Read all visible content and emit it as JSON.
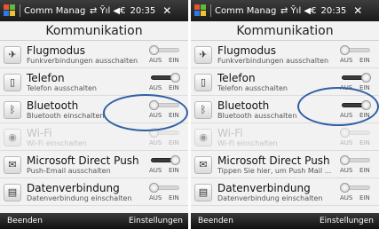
{
  "colors": {
    "highlight_ring": "#2f5fa5",
    "titlebar": "#1a1a1a",
    "toggle_on": "#3a3a3a"
  },
  "screens": [
    {
      "statusbar": {
        "app_title": "Comm Manage",
        "signal_text": "⇄ Ỹıl ◀€",
        "time": "20:35",
        "close": "✕"
      },
      "heading": "Kommunikation",
      "items": [
        {
          "title": "Flugmodus",
          "subtitle": "Funkverbindungen ausschalten",
          "icon": "airplane-icon",
          "state": "off",
          "enabled": true,
          "off_label": "AUS",
          "on_label": "EIN"
        },
        {
          "title": "Telefon",
          "subtitle": "Telefon ausschalten",
          "icon": "phone-icon",
          "state": "on",
          "enabled": true,
          "off_label": "AUS",
          "on_label": "EIN"
        },
        {
          "title": "Bluetooth",
          "subtitle": "Bluetooth einschalten",
          "icon": "bluetooth-icon",
          "state": "off",
          "enabled": true,
          "off_label": "AUS",
          "on_label": "EIN"
        },
        {
          "title": "Wi-Fi",
          "subtitle": "Wi-Fi einschalten",
          "icon": "wifi-icon",
          "state": "off",
          "enabled": false,
          "off_label": "AUS",
          "on_label": "EIN"
        },
        {
          "title": "Microsoft Direct Push",
          "subtitle": "Push-Email ausschalten",
          "icon": "push-mail-icon",
          "state": "on",
          "enabled": true,
          "off_label": "AUS",
          "on_label": "EIN"
        },
        {
          "title": "Datenverbindung",
          "subtitle": "Datenverbindung einschalten",
          "icon": "data-connection-icon",
          "state": "off",
          "enabled": true,
          "off_label": "AUS",
          "on_label": "EIN"
        }
      ],
      "menubar": {
        "left": "Beenden",
        "right": "Einstellungen"
      }
    },
    {
      "statusbar": {
        "app_title": "Comm Manage",
        "signal_text": "⇄ Ỹıl ◀€",
        "time": "20:35",
        "close": "✕"
      },
      "heading": "Kommunikation",
      "items": [
        {
          "title": "Flugmodus",
          "subtitle": "Funkverbindungen ausschalten",
          "icon": "airplane-icon",
          "state": "off",
          "enabled": true,
          "off_label": "AUS",
          "on_label": "EIN"
        },
        {
          "title": "Telefon",
          "subtitle": "Telefon ausschalten",
          "icon": "phone-icon",
          "state": "on",
          "enabled": true,
          "off_label": "AUS",
          "on_label": "EIN"
        },
        {
          "title": "Bluetooth",
          "subtitle": "Bluetooth ausschalten",
          "icon": "bluetooth-icon",
          "state": "on",
          "enabled": true,
          "off_label": "AUS",
          "on_label": "EIN"
        },
        {
          "title": "Wi-Fi",
          "subtitle": "Wi-Fi einschalten",
          "icon": "wifi-icon",
          "state": "off",
          "enabled": false,
          "off_label": "AUS",
          "on_label": "EIN"
        },
        {
          "title": "Microsoft Direct Push",
          "subtitle": "Tippen Sie hier, um Push Mail ...",
          "icon": "push-mail-icon",
          "state": "off",
          "enabled": true,
          "off_label": "AUS",
          "on_label": "EIN"
        },
        {
          "title": "Datenverbindung",
          "subtitle": "Datenverbindung einschalten",
          "icon": "data-connection-icon",
          "state": "off",
          "enabled": true,
          "off_label": "AUS",
          "on_label": "EIN"
        }
      ],
      "menubar": {
        "left": "Beenden",
        "right": "Einstellungen"
      }
    }
  ]
}
